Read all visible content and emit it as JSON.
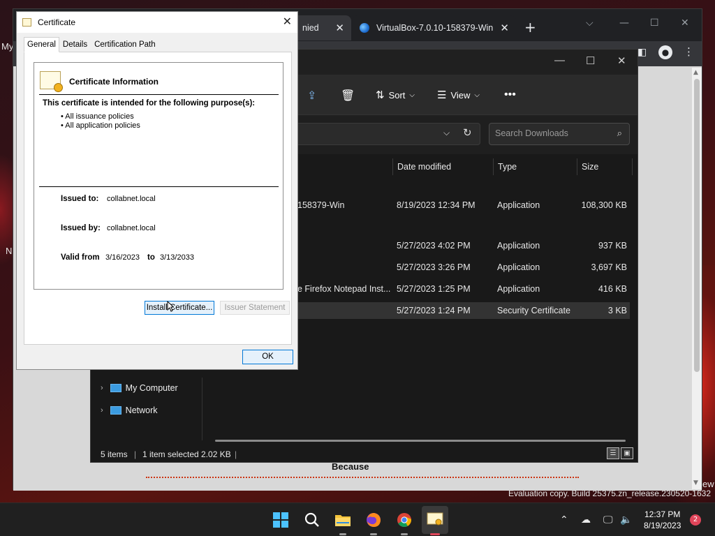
{
  "desktop": {
    "evaluation_text": "Evaluation copy. Build 25375.zn_release.230520-1632",
    "left_fragment_1": "My",
    "left_fragment_2": "N",
    "right_fragment": "ew"
  },
  "browser": {
    "tab1_label": "nied",
    "tab2_label": "VirtualBox-7.0.10-158379-Win",
    "page_word": "Because"
  },
  "explorer": {
    "commands": {
      "sort": "Sort",
      "view": "View"
    },
    "search_placeholder": "Search Downloads",
    "columns": {
      "date": "Date modified",
      "type": "Type",
      "size": "Size"
    },
    "files": [
      {
        "name": "158379-Win",
        "date": "8/19/2023 12:34 PM",
        "type": "Application",
        "size": "108,300 KB"
      },
      {
        "name": "",
        "date": "5/27/2023 4:02 PM",
        "type": "Application",
        "size": "937 KB"
      },
      {
        "name": "",
        "date": "5/27/2023 3:26 PM",
        "type": "Application",
        "size": "3,697 KB"
      },
      {
        "name": "e Firefox Notepad Inst...",
        "date": "5/27/2023 1:25 PM",
        "type": "Application",
        "size": "416 KB"
      },
      {
        "name": "",
        "date": "5/27/2023 1:24 PM",
        "type": "Security Certificate",
        "size": "3 KB"
      }
    ],
    "nav": {
      "my_computer": "My Computer",
      "network": "Network"
    },
    "status": {
      "items": "5 items",
      "selected": "1 item selected  2.02 KB"
    }
  },
  "certificate": {
    "title": "Certificate",
    "tabs": [
      "General",
      "Details",
      "Certification Path"
    ],
    "info_title": "Certificate Information",
    "purpose_title": "This certificate is intended for the following purpose(s):",
    "purposes": [
      "• All issuance policies",
      "• All application policies"
    ],
    "issued_to_label": "Issued to:",
    "issued_to": "collabnet.local",
    "issued_by_label": "Issued by:",
    "issued_by": "collabnet.local",
    "valid_from_label": "Valid from",
    "valid_from": "3/16/2023",
    "valid_to_label": "to",
    "valid_to": "3/13/2033",
    "install_button": "Install Certificate...",
    "issuer_button": "Issuer Statement",
    "ok_button": "OK"
  },
  "taskbar": {
    "time": "12:37 PM",
    "date": "8/19/2023",
    "notification_count": "2"
  },
  "colors": {
    "accent": "#0078d7",
    "windows_blue": "#4cc2ff",
    "badge": "#e0455a"
  }
}
